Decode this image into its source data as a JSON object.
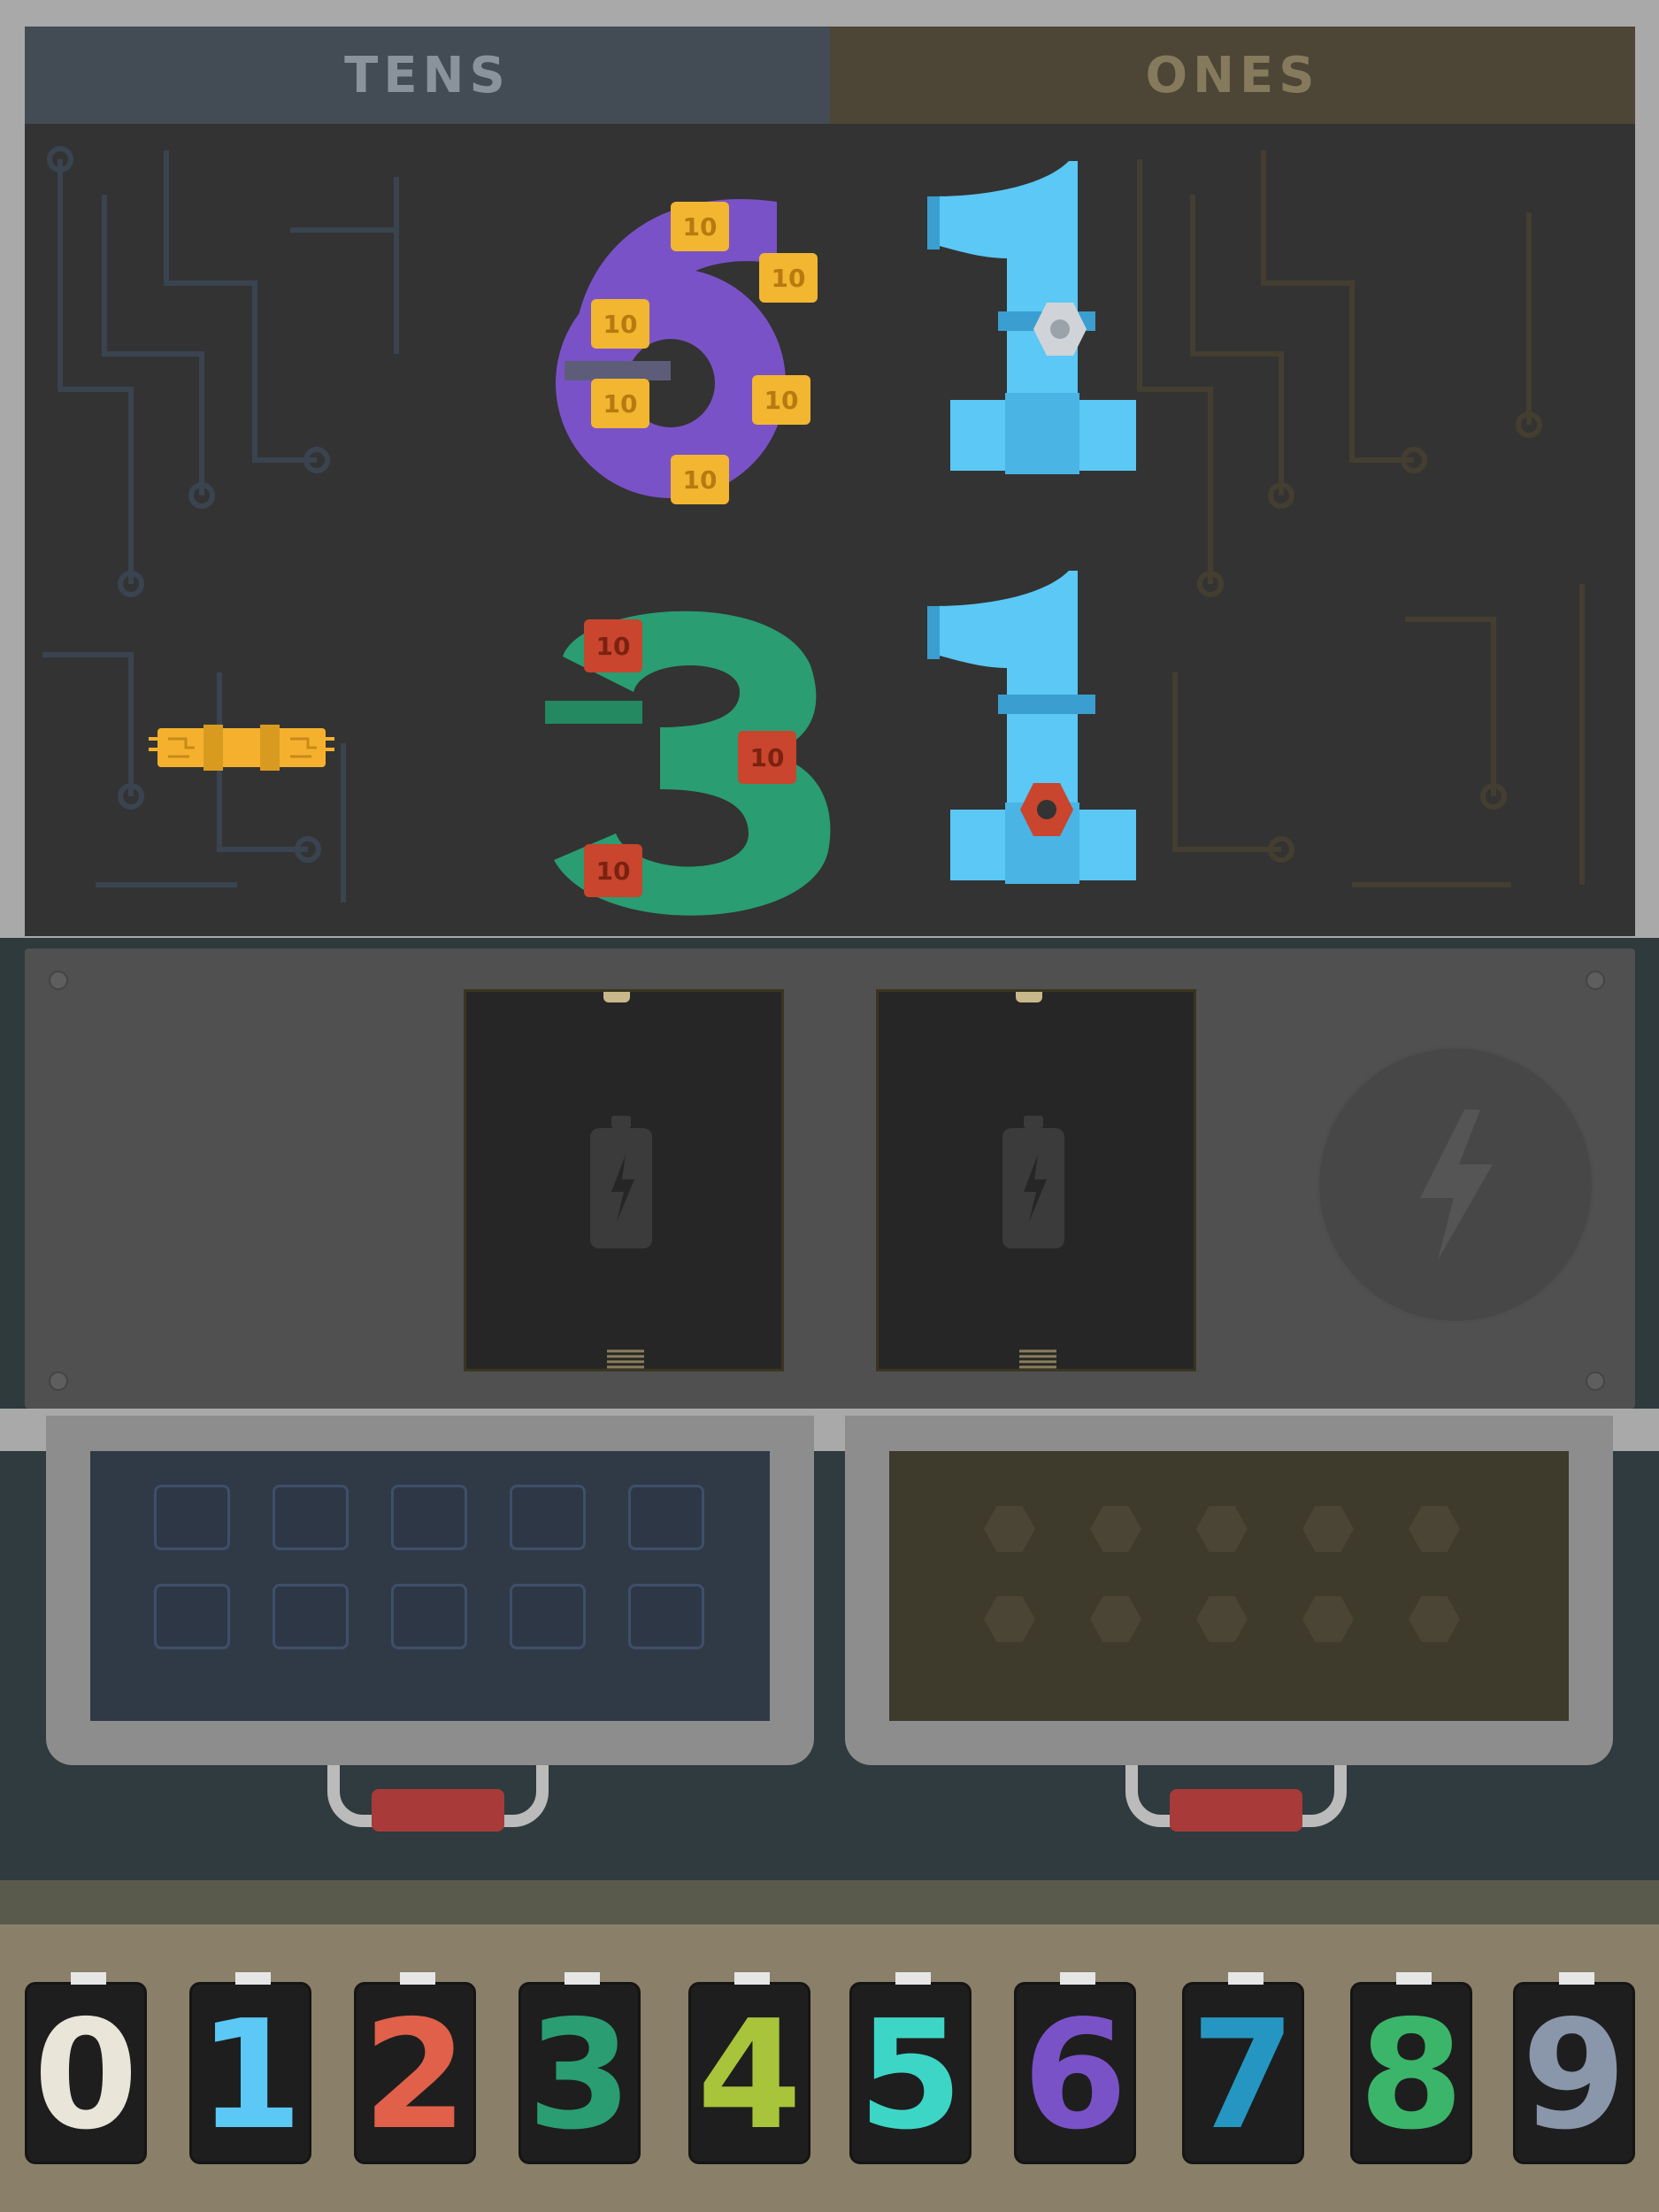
{
  "headers": {
    "tens": "TENS",
    "ones": "ONES"
  },
  "equation": {
    "top": {
      "tens_digit": "6",
      "ones_digit": "1"
    },
    "bottom": {
      "tens_digit": "3",
      "ones_digit": "1"
    },
    "operator": "minus",
    "ten_block_label": "10"
  },
  "battery_slots": [
    {
      "icon": "battery-icon",
      "state": "empty"
    },
    {
      "icon": "battery-icon",
      "state": "empty"
    }
  ],
  "power_button": {
    "icon": "lightning-icon"
  },
  "bins": [
    {
      "name": "tens-bin",
      "cell_shape": "square",
      "rows": 2,
      "cols": 5
    },
    {
      "name": "ones-bin",
      "cell_shape": "hexagon",
      "rows": 2,
      "cols": 5
    }
  ],
  "digit_tray": [
    {
      "digit": "0",
      "color": "#e9e5d8"
    },
    {
      "digit": "1",
      "color": "#5bc8f5"
    },
    {
      "digit": "2",
      "color": "#e0604a"
    },
    {
      "digit": "3",
      "color": "#2a9d72"
    },
    {
      "digit": "4",
      "color": "#a8c43a"
    },
    {
      "digit": "5",
      "color": "#3dd6c6"
    },
    {
      "digit": "6",
      "color": "#7a52c8"
    },
    {
      "digit": "7",
      "color": "#2596c2"
    },
    {
      "digit": "8",
      "color": "#3bb56a"
    },
    {
      "digit": "9",
      "color": "#8a97ab"
    }
  ],
  "colors": {
    "digit_six": "#7a52c8",
    "digit_three": "#2a9d72",
    "digit_one": "#5bc8f5",
    "ten_block_yellow": "#f2b630",
    "ten_block_red": "#c9452d",
    "minus_sign": "#f5b12e"
  }
}
